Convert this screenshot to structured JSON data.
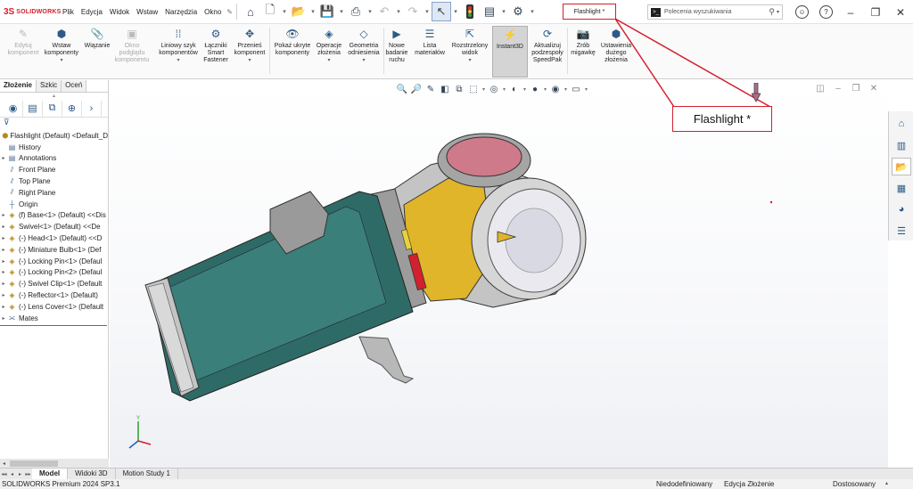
{
  "app": {
    "logo_mark": "3S",
    "logo_text": "SOLIDWORKS",
    "document_title": "Flashlight *",
    "search_placeholder": "Polecenia wyszukiwania"
  },
  "menu": [
    "Plik",
    "Edycja",
    "Widok",
    "Wstaw",
    "Narzędzia",
    "Okno"
  ],
  "ribbon": [
    {
      "label": "Edytuj\nkomponent",
      "icon": "edit-component-icon",
      "disabled": true
    },
    {
      "label": "Wstaw\nkomponenty",
      "icon": "insert-components-icon",
      "dropdown": true
    },
    {
      "label": "Wiązanie",
      "icon": "mate-icon"
    },
    {
      "label": "Okno\npodglądu\nkomponentu",
      "icon": "component-preview-icon",
      "disabled": true
    },
    {
      "label": "Liniowy szyk\nkomponentów",
      "icon": "linear-pattern-icon",
      "dropdown": true
    },
    {
      "label": "Łączniki\nSmart\nFastener",
      "icon": "smart-fasteners-icon"
    },
    {
      "label": "Przenieś\nkomponent",
      "icon": "move-component-icon",
      "dropdown": true
    },
    {
      "label": "Pokaż ukryte\nkomponenty",
      "icon": "show-hidden-icon"
    },
    {
      "label": "Operacje\nzłożenia",
      "icon": "assembly-features-icon",
      "dropdown": true
    },
    {
      "label": "Geometria\nodniesienia",
      "icon": "reference-geometry-icon",
      "dropdown": true
    },
    {
      "label": "Nowe\nbadanie\nruchu",
      "icon": "motion-study-icon"
    },
    {
      "label": "Lista\nmateriałów",
      "icon": "bom-icon"
    },
    {
      "label": "Rozstrzelony\nwidok",
      "icon": "exploded-view-icon",
      "dropdown": true
    },
    {
      "label": "Instant3D",
      "icon": "instant3d-icon",
      "active": true
    },
    {
      "label": "Aktualizuj\npodzespoły\nSpeedPak",
      "icon": "speedpak-icon"
    },
    {
      "label": "Zrób\nmigawkę",
      "icon": "snapshot-icon"
    },
    {
      "label": "Ustawienia\ndużego\nzłożenia",
      "icon": "large-assembly-icon"
    }
  ],
  "panel_tabs": [
    "Złożenie",
    "Szkic",
    "Oceń"
  ],
  "tree": [
    {
      "label": "Flashlight (Default) <Default_D",
      "type": "assembly",
      "expander": ""
    },
    {
      "label": "History",
      "type": "feature",
      "expander": ""
    },
    {
      "label": "Annotations",
      "type": "feature",
      "expander": "▸"
    },
    {
      "label": "Front Plane",
      "type": "plane",
      "expander": ""
    },
    {
      "label": "Top Plane",
      "type": "plane",
      "expander": ""
    },
    {
      "label": "Right Plane",
      "type": "plane",
      "expander": ""
    },
    {
      "label": "Origin",
      "type": "origin",
      "expander": ""
    },
    {
      "label": "(f) Base<1> (Default) <<Dis",
      "type": "part",
      "expander": "▸"
    },
    {
      "label": "Swivel<1> (Default) <<De",
      "type": "part",
      "expander": "▸"
    },
    {
      "label": "(-) Head<1> (Default) <<D",
      "type": "part",
      "expander": "▸"
    },
    {
      "label": "(-) Miniature Bulb<1> (Def",
      "type": "part",
      "expander": "▸"
    },
    {
      "label": "(-) Locking Pin<1> (Defaul",
      "type": "part",
      "expander": "▸"
    },
    {
      "label": "(-) Locking Pin<2> (Defaul",
      "type": "part",
      "expander": "▸"
    },
    {
      "label": "(-) Swivel Clip<1> (Default",
      "type": "part",
      "expander": "▸"
    },
    {
      "label": "(-) Reflector<1> (Default)",
      "type": "part",
      "expander": "▸"
    },
    {
      "label": "(-) Lens Cover<1> (Default",
      "type": "part",
      "expander": "▸"
    },
    {
      "label": "Mates",
      "type": "mates",
      "expander": "▸"
    }
  ],
  "callout": "Flashlight *",
  "bottom_tabs": [
    "Model",
    "Widoki 3D",
    "Motion Study 1"
  ],
  "status": {
    "version": "SOLIDWORKS Premium 2024 SP3.1",
    "defined": "Niedodefiniowany",
    "mode": "Edycja Złożenie",
    "units": "Dostosowany"
  },
  "colors": {
    "accent_red": "#d3202e",
    "body_green": "#2f6b66",
    "swivel_grey": "#b8b8b8",
    "head_yellow": "#e0b52a",
    "lens_pink": "#cf7a8a",
    "selection_blue": "#2b78c8"
  }
}
